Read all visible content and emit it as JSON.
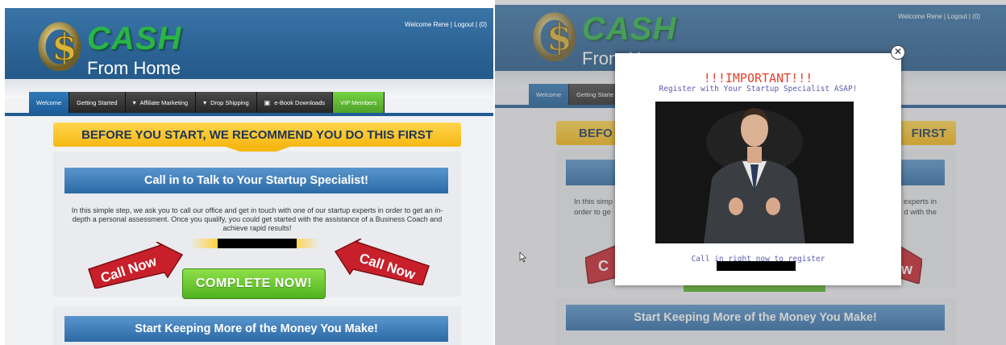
{
  "left": {
    "welcome_text": "Welcome Rene | Logout | (0)",
    "logo": {
      "cash": "CASH",
      "from_home": "From Home",
      "coin_symbol": "$"
    },
    "nav": [
      {
        "label": "Welcome",
        "bullet": ""
      },
      {
        "label": "Getting Started",
        "bullet": ""
      },
      {
        "label": "Affiliate Marketing",
        "bullet": "▾"
      },
      {
        "label": "Drop Shipping",
        "bullet": "▾"
      },
      {
        "label": "e-Book Downloads",
        "bullet": "▣"
      },
      {
        "label": "VIP Members",
        "bullet": ""
      }
    ],
    "banner": "BEFORE YOU START, WE RECOMMEND YOU DO THIS FIRST",
    "section1_title": "Call in to Talk to Your Startup Specialist!",
    "section1_text": "In this simple step, we ask you to call our office and get in touch with one of our startup experts in order to get an in-depth a personal assessment. Once you qualify, you could get started with the assistance of a Business Coach and achieve rapid results!",
    "call_now": "Call Now",
    "complete_button": "COMPLETE NOW!",
    "section2_title": "Start Keeping More of the Money You Make!"
  },
  "right": {
    "welcome_text": "Welcome Rene | Logout | (0)",
    "logo": {
      "cash": "CASH",
      "from_home": "From Home",
      "coin_symbol": "$"
    },
    "nav": [
      {
        "label": "Welcome"
      },
      {
        "label": "Getting Starte"
      }
    ],
    "banner_left": "BEFO",
    "banner_right": "FIRST",
    "text_left_1": "In this simp",
    "text_left_2": "order to ge",
    "text_right_1": "experts in",
    "text_right_2": "d with the",
    "section2_title": "Start Keeping More of the Money You Make!",
    "modal": {
      "title": "!!!IMPORTANT!!!",
      "subtitle": "Register with Your Startup Specialist ASAP!",
      "call_text": "Call in right now to register",
      "close_symbol": "✕"
    }
  },
  "colors": {
    "header_blue": "#2c6395",
    "nav_blue": "#1f5c94",
    "banner_yellow": "#f6b712",
    "green_button": "#4fb21f",
    "call_red": "#c8202a",
    "modal_title_red": "#e43f2b",
    "modal_text_purple": "#5c5bb0"
  }
}
